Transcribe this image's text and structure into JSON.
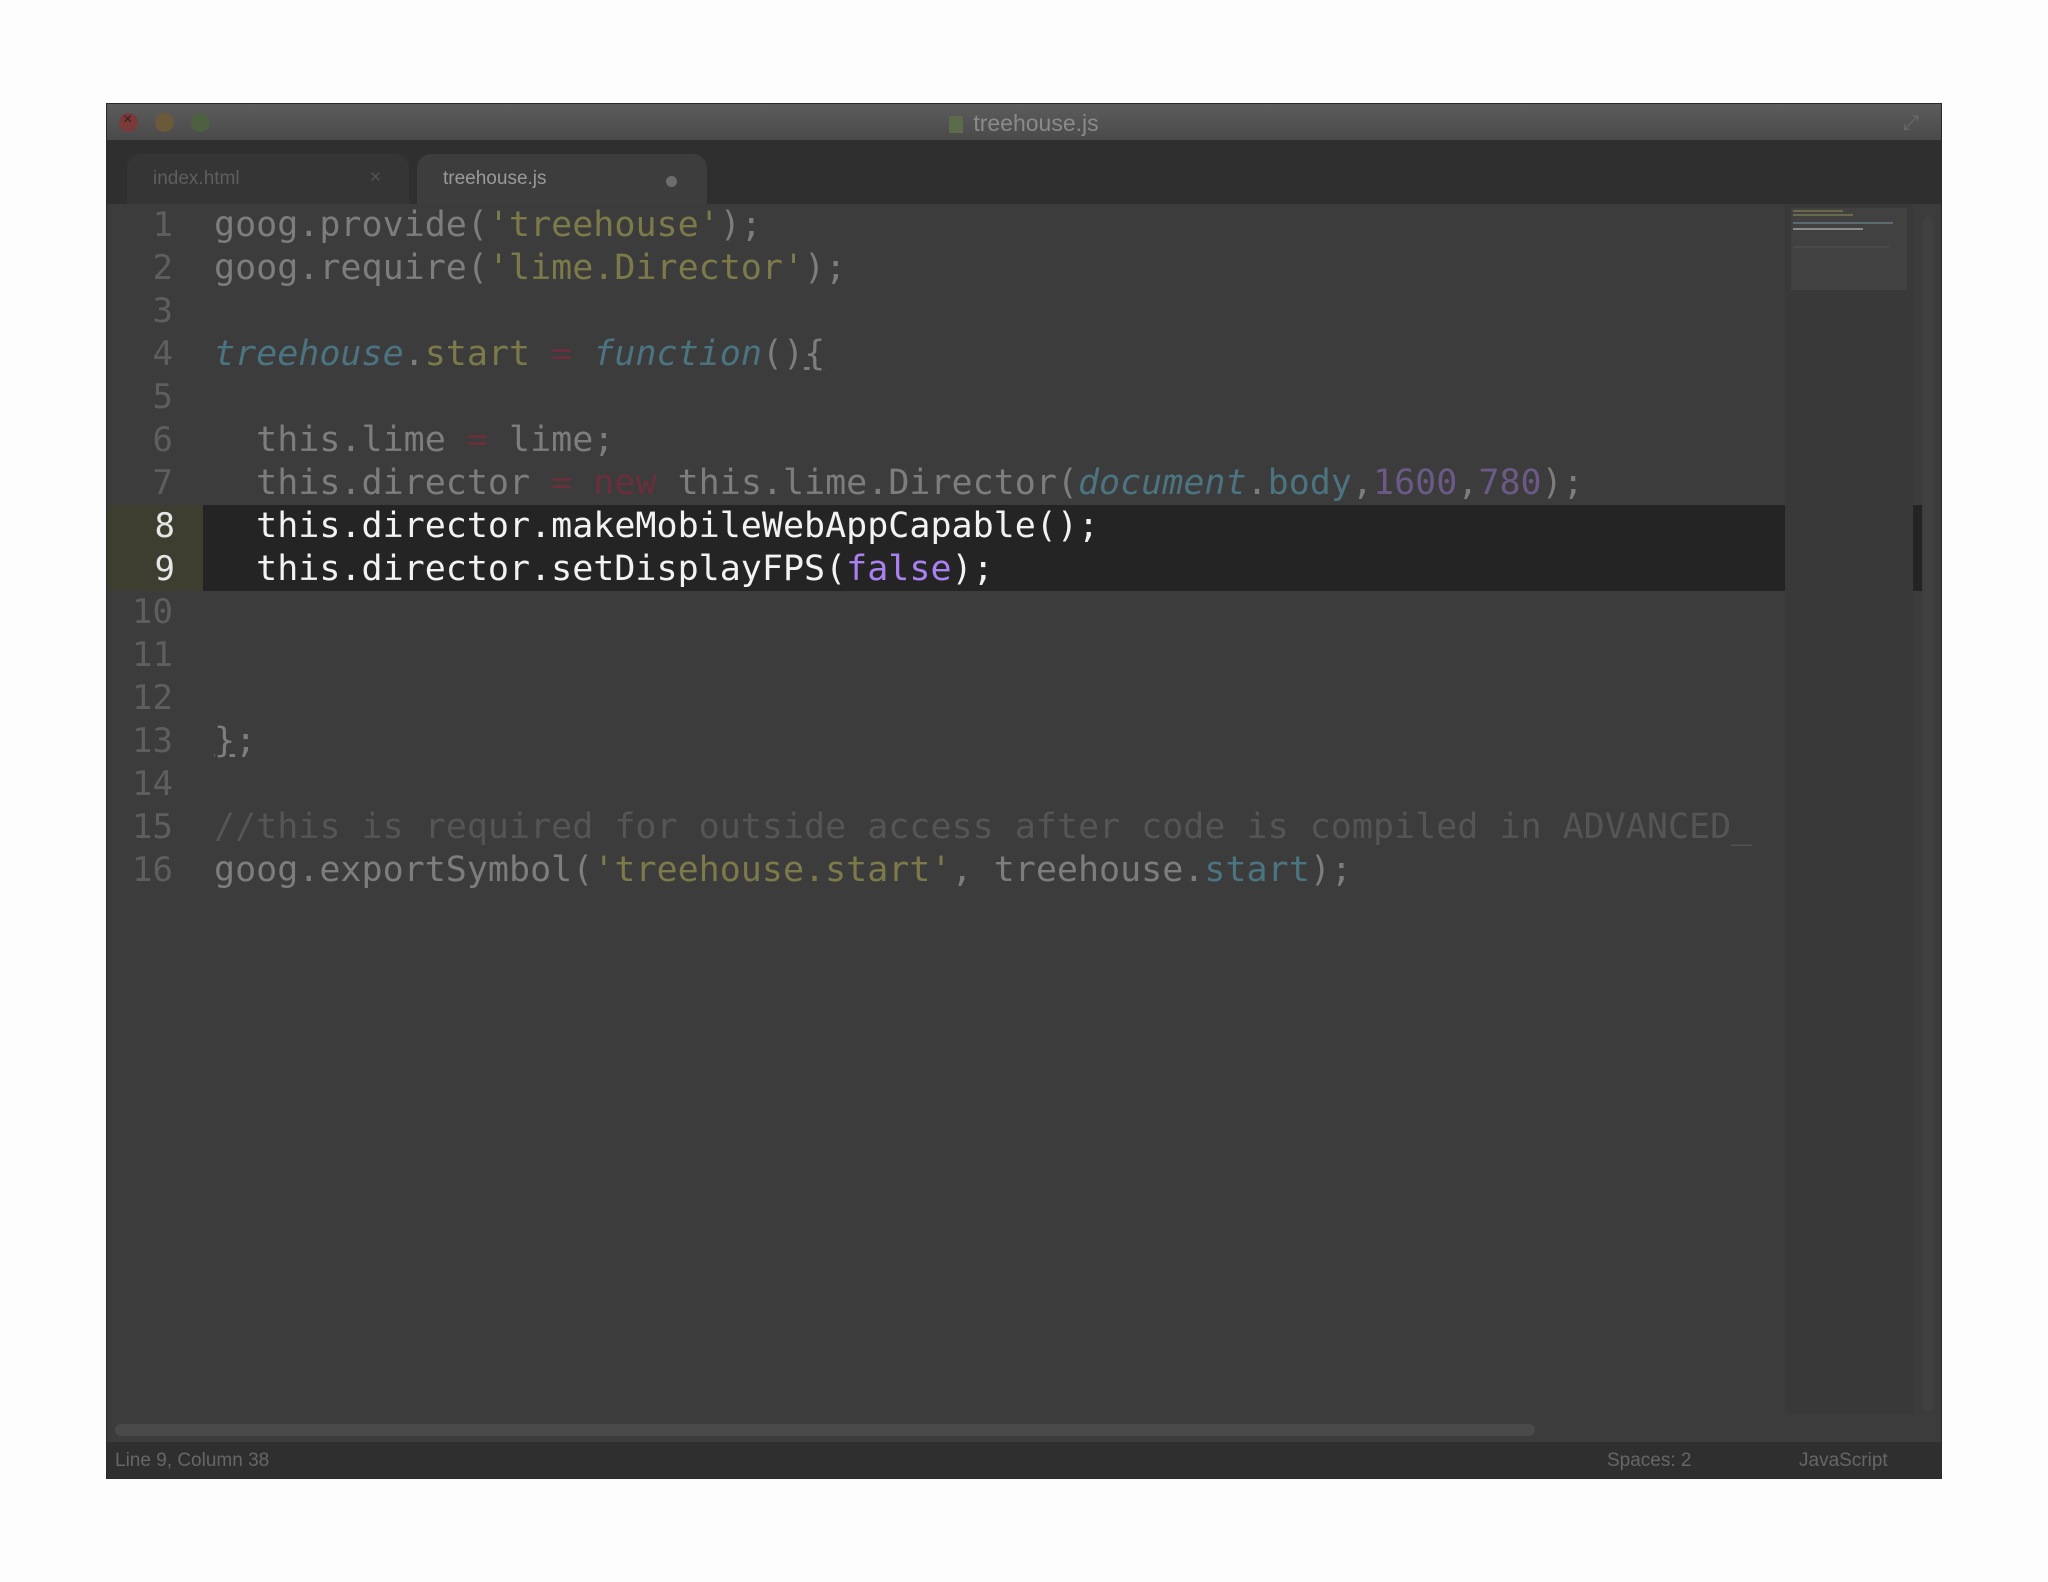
{
  "window": {
    "title": "treehouse.js"
  },
  "tabs": [
    {
      "label": "index.html",
      "state": "inactive",
      "close_glyph": "×"
    },
    {
      "label": "treehouse.js",
      "state": "active",
      "modified": true
    }
  ],
  "editor": {
    "cursor_line": 9,
    "highlighted_lines": [
      8,
      9
    ],
    "lines": [
      {
        "number": "1",
        "text": "goog.provide('treehouse');"
      },
      {
        "number": "2",
        "text": "goog.require('lime.Director');"
      },
      {
        "number": "3",
        "text": ""
      },
      {
        "number": "4",
        "text": "treehouse.start = function(){"
      },
      {
        "number": "5",
        "text": ""
      },
      {
        "number": "6",
        "text": "  this.lime = lime;"
      },
      {
        "number": "7",
        "text": "  this.director = new this.lime.Director(document.body,1600,780);"
      },
      {
        "number": "8",
        "text": "  this.director.makeMobileWebAppCapable();"
      },
      {
        "number": "9",
        "text": "  this.director.setDisplayFPS(false);"
      },
      {
        "number": "10",
        "text": ""
      },
      {
        "number": "11",
        "text": ""
      },
      {
        "number": "12",
        "text": ""
      },
      {
        "number": "13",
        "text": "};"
      },
      {
        "number": "14",
        "text": ""
      },
      {
        "number": "15",
        "text": "//this is required for outside access after code is compiled in ADVANCED_"
      },
      {
        "number": "16",
        "text": "goog.exportSymbol('treehouse.start', treehouse.start);"
      }
    ]
  },
  "status": {
    "position": "Line 9, Column 38",
    "indent": "Spaces: 2",
    "syntax": "JavaScript"
  },
  "colors": {
    "highlight_line_bg": "#242424",
    "caret_icon": "#3fc3ee",
    "string": "#7d7a4a",
    "keyword": "#6a2f3a",
    "number": "#6a5a85",
    "boolean": "#a981f0"
  },
  "icons": {
    "window_close": "close-icon",
    "window_minimize": "minimize-icon",
    "window_zoom": "zoom-icon",
    "fullscreen": "fullscreen-icon",
    "text_caret": "i-beam-cursor-icon",
    "file": "file-icon"
  }
}
